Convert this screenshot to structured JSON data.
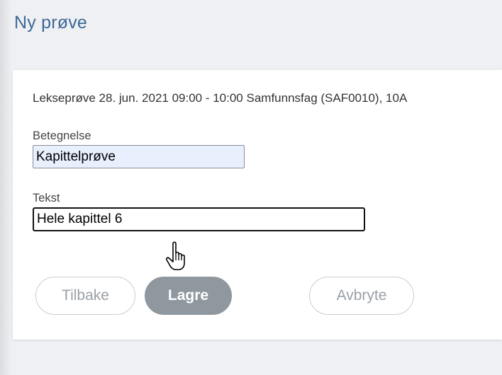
{
  "page": {
    "title": "Ny prøve"
  },
  "card": {
    "info_line": "Lekseprøve 28. jun. 2021 09:00 - 10:00 Samfunnsfag (SAF0010), 10A",
    "fields": {
      "betegnelse": {
        "label": "Betegnelse",
        "value": "Kapittelprøve"
      },
      "tekst": {
        "label": "Tekst",
        "value": "Hele kapittel 6"
      }
    },
    "buttons": {
      "back": "Tilbake",
      "save": "Lagre",
      "cancel": "Avbryte"
    }
  },
  "cursor": {
    "icon": "hand-pointer-icon"
  },
  "colors": {
    "title": "#3f6896",
    "save_button_bg": "#8f979f",
    "outline_button_text": "#9aa0a6",
    "autofill_bg": "#e8f0fe"
  }
}
